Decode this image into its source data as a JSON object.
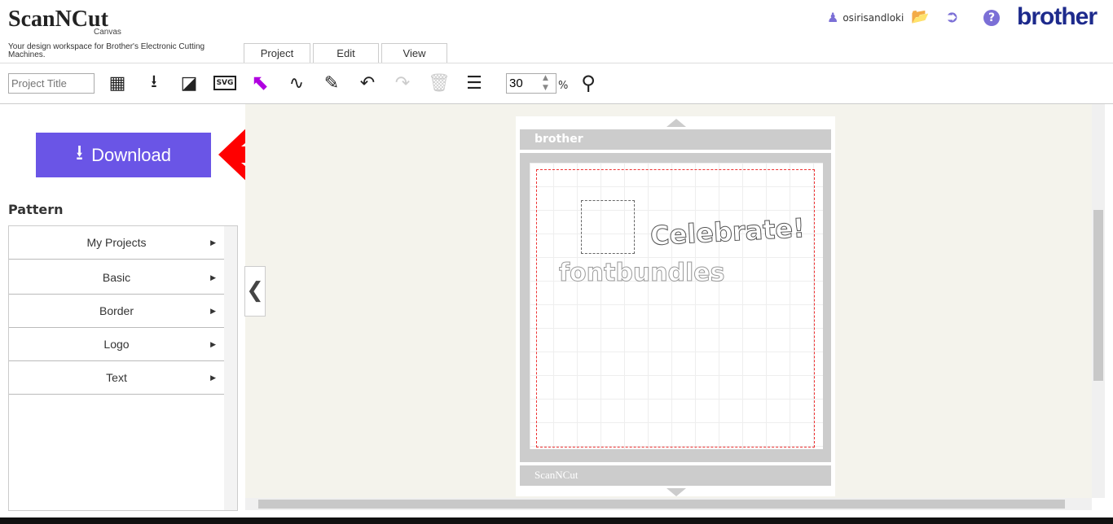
{
  "header": {
    "logo": "ScanNCut",
    "logo_sub": "Canvas",
    "tagline": "Your design workspace for Brother's Electronic Cutting Machines.",
    "username": "osirisandloki",
    "brand": "brother"
  },
  "tabs": [
    {
      "label": "Project"
    },
    {
      "label": "Edit"
    },
    {
      "label": "View"
    }
  ],
  "toolbar": {
    "project_title_placeholder": "Project Title",
    "zoom_value": "30",
    "zoom_unit": "%"
  },
  "sidebar": {
    "download_label": "Download",
    "pattern_heading": "Pattern",
    "items": [
      {
        "label": "My Projects"
      },
      {
        "label": "Basic"
      },
      {
        "label": "Border"
      },
      {
        "label": "Logo"
      },
      {
        "label": "Text"
      }
    ]
  },
  "mat": {
    "top_brand": "brother",
    "bottom_brand": "ScanNCut",
    "designs": [
      "Celebrate!",
      "fontbundles"
    ]
  },
  "colors": {
    "accent": "#6a55e6",
    "brand": "#1d2a8c",
    "arrow": "#ff0000",
    "icon": "#7b6fd6"
  }
}
